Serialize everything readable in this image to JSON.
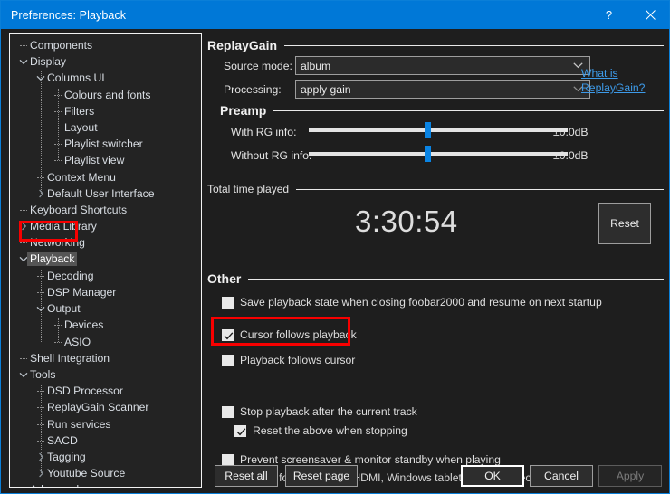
{
  "window": {
    "title": "Preferences: Playback",
    "help_icon": "question-mark-icon",
    "close_icon": "close-icon",
    "accent_color": "#0078d7"
  },
  "sidebar": {
    "items": [
      {
        "label": "Components",
        "depth": 0,
        "twisty": "none",
        "selected": false
      },
      {
        "label": "Display",
        "depth": 0,
        "twisty": "expanded",
        "selected": false
      },
      {
        "label": "Columns UI",
        "depth": 1,
        "twisty": "expanded",
        "selected": false
      },
      {
        "label": "Colours and fonts",
        "depth": 2,
        "twisty": "none",
        "selected": false
      },
      {
        "label": "Filters",
        "depth": 2,
        "twisty": "none",
        "selected": false
      },
      {
        "label": "Layout",
        "depth": 2,
        "twisty": "none",
        "selected": false
      },
      {
        "label": "Playlist switcher",
        "depth": 2,
        "twisty": "none",
        "selected": false
      },
      {
        "label": "Playlist view",
        "depth": 2,
        "twisty": "none",
        "selected": false
      },
      {
        "label": "Context Menu",
        "depth": 1,
        "twisty": "none",
        "selected": false
      },
      {
        "label": "Default User Interface",
        "depth": 1,
        "twisty": "collapsed",
        "selected": false
      },
      {
        "label": "Keyboard Shortcuts",
        "depth": 0,
        "twisty": "none",
        "selected": false
      },
      {
        "label": "Media Library",
        "depth": 0,
        "twisty": "collapsed",
        "selected": false
      },
      {
        "label": "Networking",
        "depth": 0,
        "twisty": "none",
        "selected": false
      },
      {
        "label": "Playback",
        "depth": 0,
        "twisty": "expanded",
        "selected": true
      },
      {
        "label": "Decoding",
        "depth": 1,
        "twisty": "none",
        "selected": false
      },
      {
        "label": "DSP Manager",
        "depth": 1,
        "twisty": "none",
        "selected": false
      },
      {
        "label": "Output",
        "depth": 1,
        "twisty": "expanded",
        "selected": false
      },
      {
        "label": "Devices",
        "depth": 2,
        "twisty": "none",
        "selected": false
      },
      {
        "label": "ASIO",
        "depth": 2,
        "twisty": "none",
        "selected": false
      },
      {
        "label": "Shell Integration",
        "depth": 0,
        "twisty": "none",
        "selected": false
      },
      {
        "label": "Tools",
        "depth": 0,
        "twisty": "expanded",
        "selected": false
      },
      {
        "label": "DSD Processor",
        "depth": 1,
        "twisty": "none",
        "selected": false
      },
      {
        "label": "ReplayGain Scanner",
        "depth": 1,
        "twisty": "none",
        "selected": false
      },
      {
        "label": "Run services",
        "depth": 1,
        "twisty": "none",
        "selected": false
      },
      {
        "label": "SACD",
        "depth": 1,
        "twisty": "none",
        "selected": false
      },
      {
        "label": "Tagging",
        "depth": 1,
        "twisty": "collapsed",
        "selected": false
      },
      {
        "label": "Youtube Source",
        "depth": 1,
        "twisty": "collapsed",
        "selected": false
      },
      {
        "label": "Advanced",
        "depth": 0,
        "twisty": "none",
        "selected": false
      }
    ]
  },
  "replaygain": {
    "group_title": "ReplayGain",
    "source_mode_label": "Source mode:",
    "source_mode_value": "album",
    "processing_label": "Processing:",
    "processing_value": "apply gain",
    "link_line1": "What is",
    "link_line2": "ReplayGain?"
  },
  "preamp": {
    "group_title": "Preamp",
    "with_rg_label": "With RG info:",
    "with_rg_value": "±0.0dB",
    "with_rg_percent": 46,
    "without_rg_label": "Without RG info:",
    "without_rg_value": "±0.0dB",
    "without_rg_percent": 46
  },
  "total_time": {
    "group_title": "Total time played",
    "value": "3:30:54",
    "reset_button": "Reset"
  },
  "other": {
    "group_title": "Other",
    "options": [
      {
        "label": "Save playback state when closing foobar2000 and resume on next startup",
        "checked": false
      },
      {
        "label": "Cursor follows playback",
        "checked": true
      },
      {
        "label": "Playback follows cursor",
        "checked": false
      },
      {
        "label": "Stop playback after the current track",
        "checked": false
      },
      {
        "label": "Reset the above when stopping",
        "checked": true
      },
      {
        "label": "Prevent screensaver & monitor standby when playing",
        "checked": false
      }
    ],
    "note": "Needed for: audio over HDMI, Windows tablets with Connected Standby"
  },
  "footer": {
    "reset_all": "Reset all",
    "reset_page": "Reset page",
    "ok": "OK",
    "cancel": "Cancel",
    "apply": "Apply"
  },
  "highlights": {
    "color": "#f80000",
    "boxes": [
      {
        "name": "playback-tree-item-highlight"
      },
      {
        "name": "cursor-follows-playback-highlight"
      }
    ]
  }
}
